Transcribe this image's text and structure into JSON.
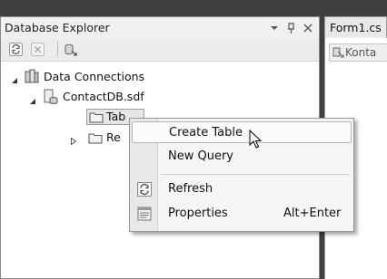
{
  "database_explorer": {
    "title": "Database Explorer",
    "title_buttons": [
      "dropdown-arrow-icon",
      "pin-icon",
      "close-icon"
    ],
    "toolbar": [
      "refresh-icon",
      "stop-icon",
      "connect-to-database-icon"
    ],
    "tree": {
      "root": {
        "label": "Data Connections",
        "expanded": true
      },
      "connection": {
        "label": "ContactDB.sdf",
        "expanded": true
      },
      "tables": {
        "label": "Tables",
        "visible_label": "Tab",
        "selected": true
      },
      "replication": {
        "label": "Replication",
        "visible_label": "Re",
        "expanded": false
      }
    }
  },
  "document": {
    "tab_label": "Form1.cs",
    "chip_label": "Konta"
  },
  "context_menu": {
    "items": [
      {
        "label": "Create Table",
        "icon": "",
        "shortcut": "",
        "highlighted": true
      },
      {
        "label": "New Query",
        "icon": "",
        "shortcut": ""
      },
      {
        "label": "Refresh",
        "icon": "refresh-icon",
        "shortcut": ""
      },
      {
        "label": "Properties",
        "icon": "properties-icon",
        "shortcut": "Alt+Enter"
      }
    ]
  }
}
